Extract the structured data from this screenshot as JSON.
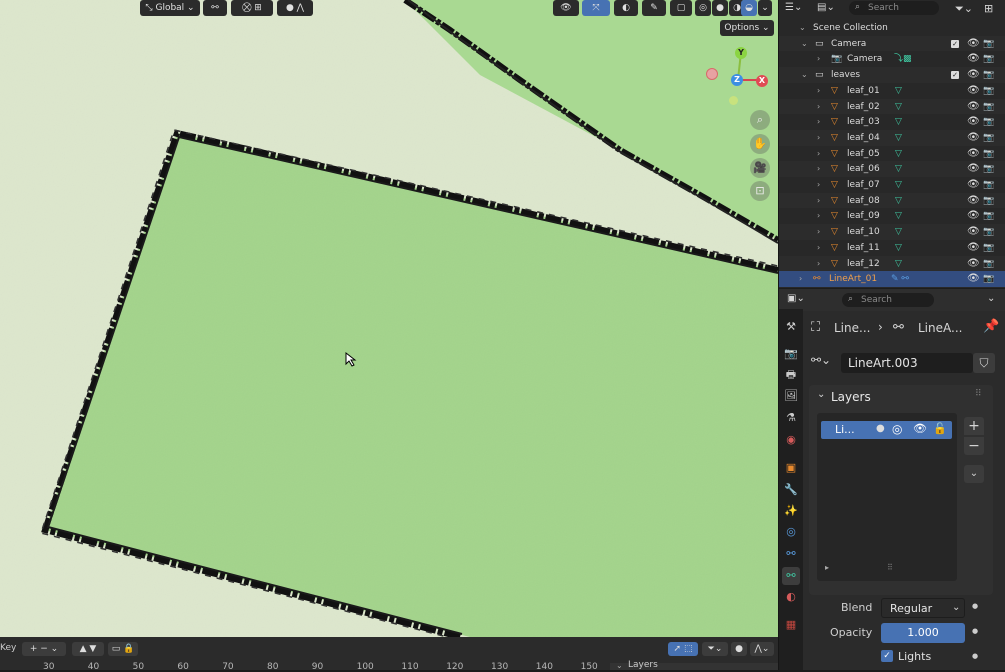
{
  "viewport": {
    "header": {
      "transform_orientation": "Global",
      "options_label": "Options"
    },
    "gizmo": {
      "y": "Y",
      "z": "Z",
      "x": "X"
    }
  },
  "outliner": {
    "search_placeholder": "Search",
    "scene_collection": "Scene Collection",
    "camera_collection": "Camera",
    "camera_object": "Camera",
    "leaves_collection": "leaves",
    "leaves": [
      "leaf_01",
      "leaf_02",
      "leaf_03",
      "leaf_04",
      "leaf_05",
      "leaf_06",
      "leaf_07",
      "leaf_08",
      "leaf_09",
      "leaf_10",
      "leaf_11",
      "leaf_12"
    ],
    "selected_object": "LineArt_01"
  },
  "properties": {
    "search_placeholder": "Search",
    "breadcrumb_object": "Line...",
    "breadcrumb_data": "LineA...",
    "datablock_name": "LineArt.003",
    "layers_panel_title": "Layers",
    "layer_item_label": "Li...",
    "blend_label": "Blend",
    "blend_value": "Regular",
    "opacity_label": "Opacity",
    "opacity_value": "1.000",
    "lights_label": "Lights"
  },
  "timeline": {
    "key_label": "Key",
    "frame_numbers": [
      "30",
      "40",
      "50",
      "60",
      "70",
      "80",
      "90",
      "100",
      "110",
      "120",
      "130",
      "140",
      "150"
    ],
    "layers_label": "Layers"
  },
  "colors": {
    "accent_blue": "#4772b3",
    "selected_row": "#334d80",
    "leaf_icon": "#e88a2e",
    "mesh_icon": "#3fc6a0",
    "canvas_green": "#a6d68f"
  }
}
